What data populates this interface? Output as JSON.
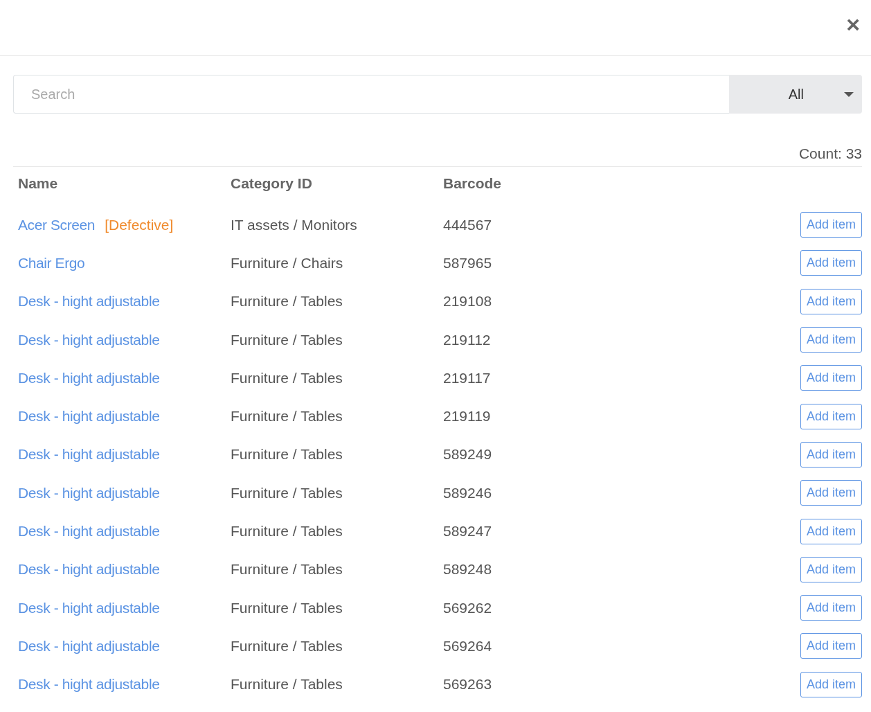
{
  "close_button": {
    "label": "×"
  },
  "search": {
    "placeholder": "Search"
  },
  "filter": {
    "value": "All"
  },
  "count": "Count: 33",
  "table": {
    "columns": [
      "Name",
      "Category ID",
      "Barcode"
    ],
    "rows": [
      {
        "name": "Acer Screen",
        "tag": "[Defective]",
        "category": "IT assets / Monitors",
        "barcode": "444567",
        "action": "Add item"
      },
      {
        "name": "Chair Ergo",
        "category": "Furniture / Chairs",
        "barcode": "587965",
        "action": "Add item"
      },
      {
        "name": "Desk - hight adjustable",
        "category": "Furniture / Tables",
        "barcode": "219108",
        "action": "Add item"
      },
      {
        "name": "Desk - hight adjustable",
        "category": "Furniture / Tables",
        "barcode": "219112",
        "action": "Add item"
      },
      {
        "name": "Desk - hight adjustable",
        "category": "Furniture / Tables",
        "barcode": "219117",
        "action": "Add item"
      },
      {
        "name": "Desk - hight adjustable",
        "category": "Furniture / Tables",
        "barcode": "219119",
        "action": "Add item"
      },
      {
        "name": "Desk - hight adjustable",
        "category": "Furniture / Tables",
        "barcode": "589249",
        "action": "Add item"
      },
      {
        "name": "Desk - hight adjustable",
        "category": "Furniture / Tables",
        "barcode": "589246",
        "action": "Add item"
      },
      {
        "name": "Desk - hight adjustable",
        "category": "Furniture / Tables",
        "barcode": "589247",
        "action": "Add item"
      },
      {
        "name": "Desk - hight adjustable",
        "category": "Furniture / Tables",
        "barcode": "589248",
        "action": "Add item"
      },
      {
        "name": "Desk - hight adjustable",
        "category": "Furniture / Tables",
        "barcode": "569262",
        "action": "Add item"
      },
      {
        "name": "Desk - hight adjustable",
        "category": "Furniture / Tables",
        "barcode": "569264",
        "action": "Add item"
      },
      {
        "name": "Desk - hight adjustable",
        "category": "Furniture / Tables",
        "barcode": "569263",
        "action": "Add item"
      }
    ]
  }
}
